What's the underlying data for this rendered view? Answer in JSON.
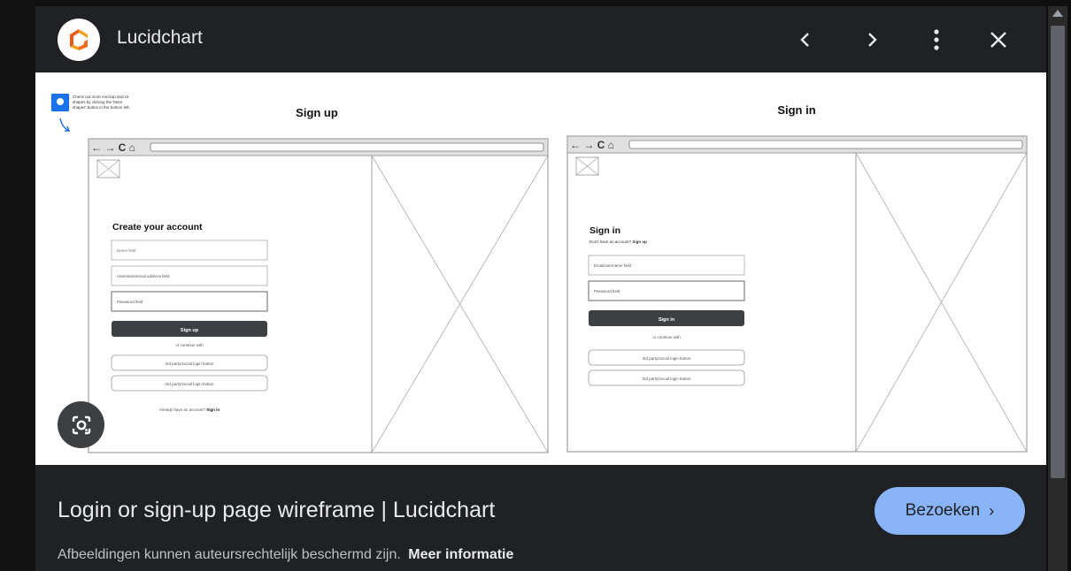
{
  "header": {
    "site_name": "Lucidchart",
    "brand_color": "#f26b1d",
    "icons": [
      "lucidchart-logo-icon",
      "chevron-left-icon",
      "chevron-right-icon",
      "more-vert-icon",
      "close-icon"
    ]
  },
  "preview": {
    "tip_text": [
      "Check out more mockup and UI",
      "shapes by clicking the 'More",
      "shapes' button in the bottom left."
    ],
    "signup": {
      "label": "Sign up",
      "heading": "Create your account",
      "name_field": "Name field",
      "email_field": "Username/email address field",
      "password_field": "Password field",
      "button": "Sign up",
      "continue": "or continue with",
      "social1": "3rd party/social login button",
      "social2": "3rd party/social login button",
      "footer_text": "Already have an account?",
      "footer_link": "Sign in"
    },
    "signin": {
      "label": "Sign in",
      "heading": "Sign in",
      "sub_text": "Don't have an account?",
      "sub_link": "Sign up",
      "email_field": "Email/username field",
      "password_field": "Password field",
      "button": "Sign in",
      "continue": "or continue with",
      "social1": "3rd party/social login button",
      "social2": "3rd party/social login button"
    }
  },
  "footer": {
    "title": "Login or sign-up page wireframe | Lucidchart",
    "visit_label": "Bezoeken",
    "copyright": "Afbeeldingen kunnen auteursrechtelijk beschermd zijn.",
    "more_info": "Meer informatie"
  }
}
